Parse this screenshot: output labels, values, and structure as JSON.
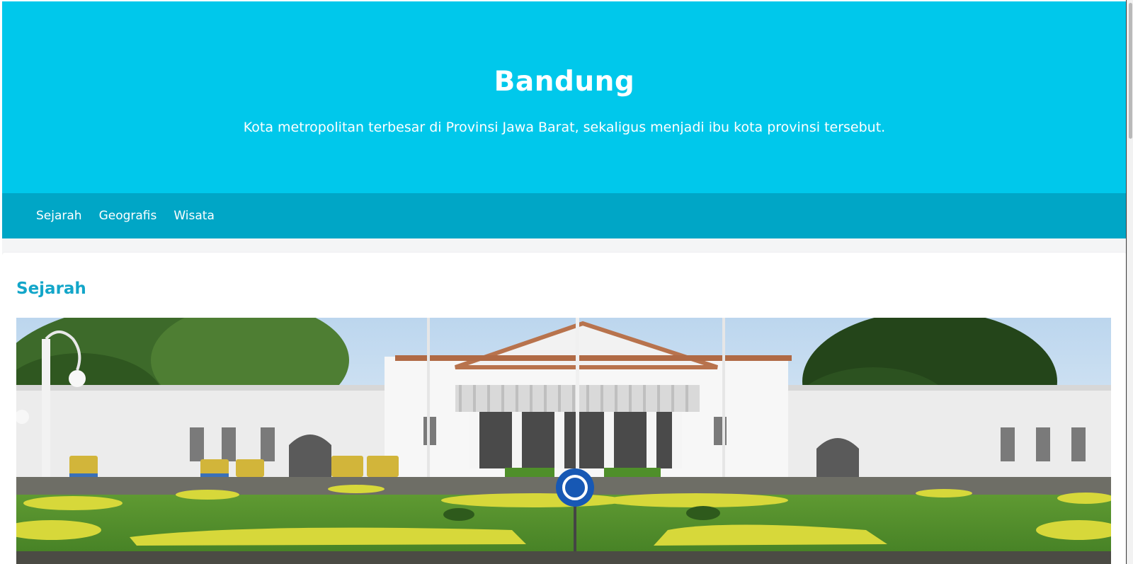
{
  "hero": {
    "title": "Bandung",
    "subtitle": "Kota metropolitan terbesar di Provinsi Jawa Barat, sekaligus menjadi ibu kota provinsi tersebut."
  },
  "nav": {
    "items": [
      {
        "label": "Sejarah"
      },
      {
        "label": "Geografis"
      },
      {
        "label": "Wisata"
      }
    ]
  },
  "section": {
    "title": "Sejarah",
    "image_alt": "Gedung Pakuan"
  },
  "colors": {
    "hero_bg": "#00c8eb",
    "nav_bg": "#00a6c6",
    "heading_accent": "#13a6c9",
    "text_light": "#ffffff"
  }
}
